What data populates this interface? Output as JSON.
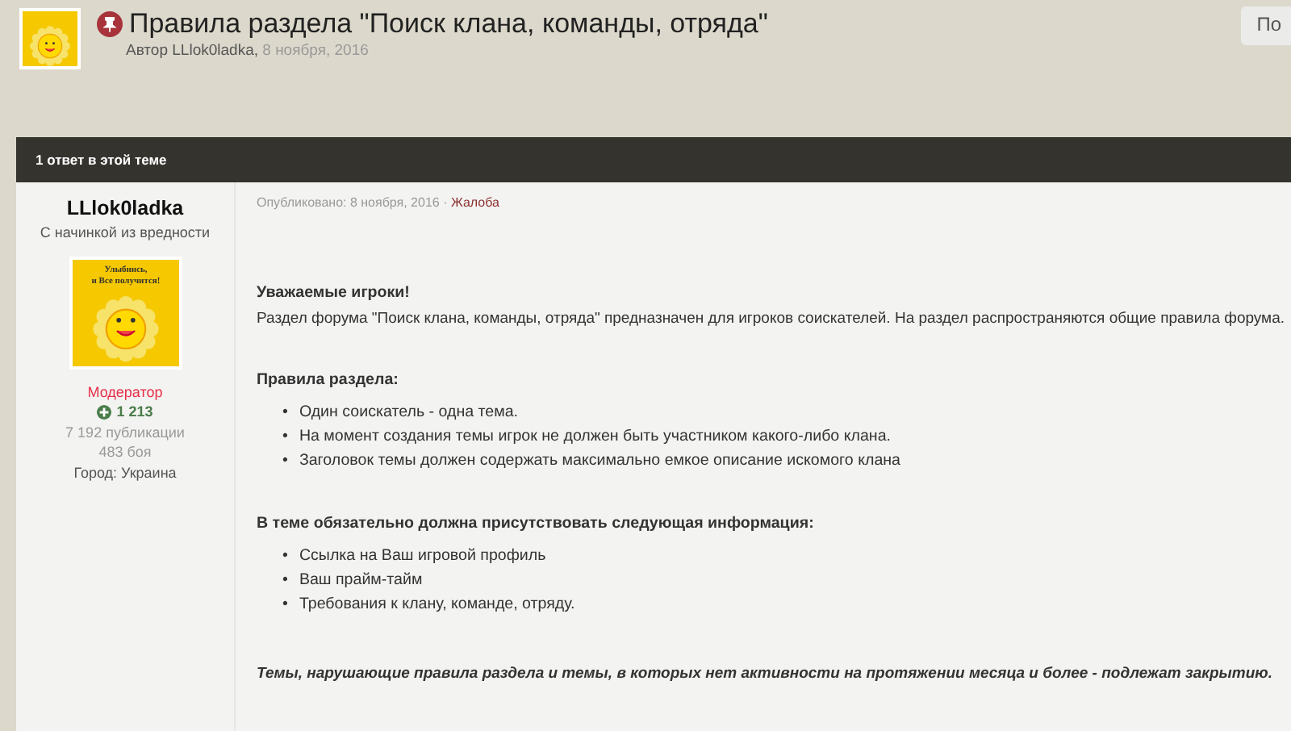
{
  "topic": {
    "title": "Правила раздела \"Поиск клана, команды, отряда\"",
    "pinned": true,
    "author_prefix": "Автор",
    "author": "LLlok0ladka,",
    "date": "8 ноября, 2016",
    "button": "По"
  },
  "replies_bar": "1 ответ в этой теме",
  "post": {
    "author": {
      "name": "LLlok0ladka",
      "title": "С начинкой из вредности",
      "avatar_text": [
        "Улыбнись,",
        "и Все получится!"
      ],
      "role": "Модератор",
      "reputation": "1 213",
      "posts": "7 192 публикации",
      "battles": "483 боя",
      "city": "Город: Украина"
    },
    "meta": {
      "published": "Опубликовано: 8 ноября, 2016",
      "separator": "·",
      "report": "Жалоба"
    },
    "blocks": [
      {
        "kind": "heading",
        "text": "Уважаемые игроки!"
      },
      {
        "kind": "paragraph",
        "text": "Раздел форума \"Поиск клана, команды, отряда\" предназначен для игроков соискателей. На раздел распространяются общие правила форума."
      },
      {
        "kind": "heading",
        "text": "Правила раздела:"
      },
      {
        "kind": "list",
        "marker": "•",
        "items": [
          "Один соискатель - одна тема.",
          "На момент создания темы игрок не должен быть участником какого-либо клана.",
          "Заголовок темы должен содержать максимально емкое описание искомого клана"
        ]
      },
      {
        "kind": "heading",
        "text": "В теме обязательно должна присутствовать следующая информация:"
      },
      {
        "kind": "list",
        "marker": "•",
        "items": [
          "Ссылка на Ваш игровой профиль",
          "Ваш прайм-тайм",
          "Требования к клану, команде, отряду."
        ]
      },
      {
        "kind": "note",
        "text": "Темы, нарушающие правила раздела  и темы, в которых нет активности на протяжении месяца и более - подлежат закрытию."
      }
    ]
  }
}
